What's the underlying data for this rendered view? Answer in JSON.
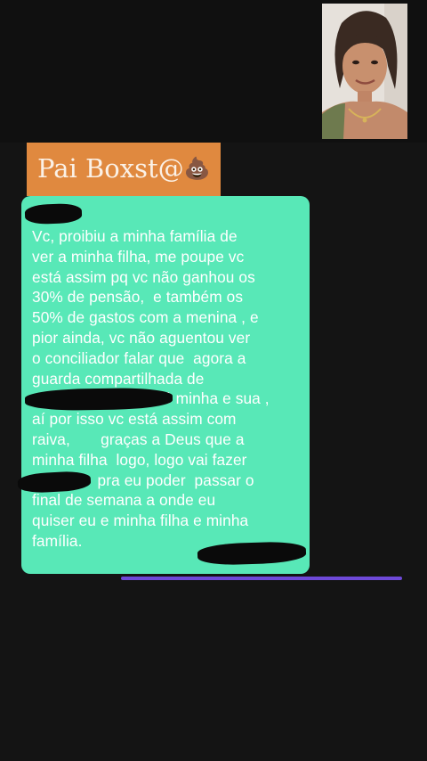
{
  "header": {
    "contact_name": "Pai Boxst@",
    "contact_emoji": "💩"
  },
  "message": {
    "text": "Vc, proibiu a minha família de\nver a minha filha, me poupe vc\nestá assim pq vc não ganhou os\n30% de pensão,  e também os\n50% de gastos com a menina , e\npior ainda, vc não aguentou ver\no conciliador falar que  agora a\nguarda compartilhada de\n                              é minha e sua ,\naí por isso vc está assim com\nraiva,       graças a Deus que a\nminha filha  logo, logo vai fazer\n               pra eu poder  passar o\nfinal de semana a onde eu\nquiser eu e minha filha e minha\nfamília."
  },
  "colors": {
    "background": "#141414",
    "label_bg": "#e0893f",
    "bubble_bg": "#58e8b7",
    "accent_line": "#6e49d8"
  }
}
